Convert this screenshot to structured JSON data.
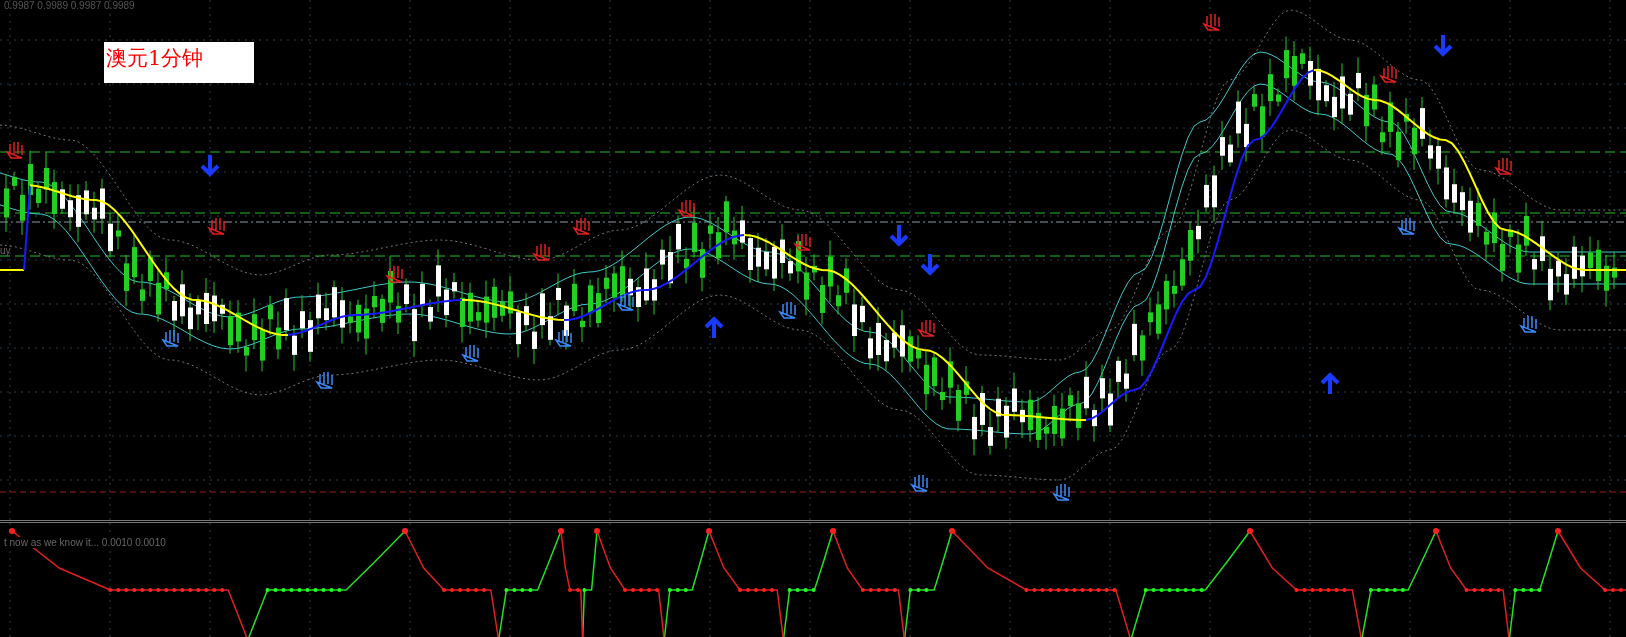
{
  "chart": {
    "readout": "0.9987 0.9989 0.9987 0.9989",
    "title_label": "澳元1分钟",
    "edge_label": "uy"
  },
  "indicator": {
    "readout": "t now as we know it... 0.0010 0.0010"
  }
}
